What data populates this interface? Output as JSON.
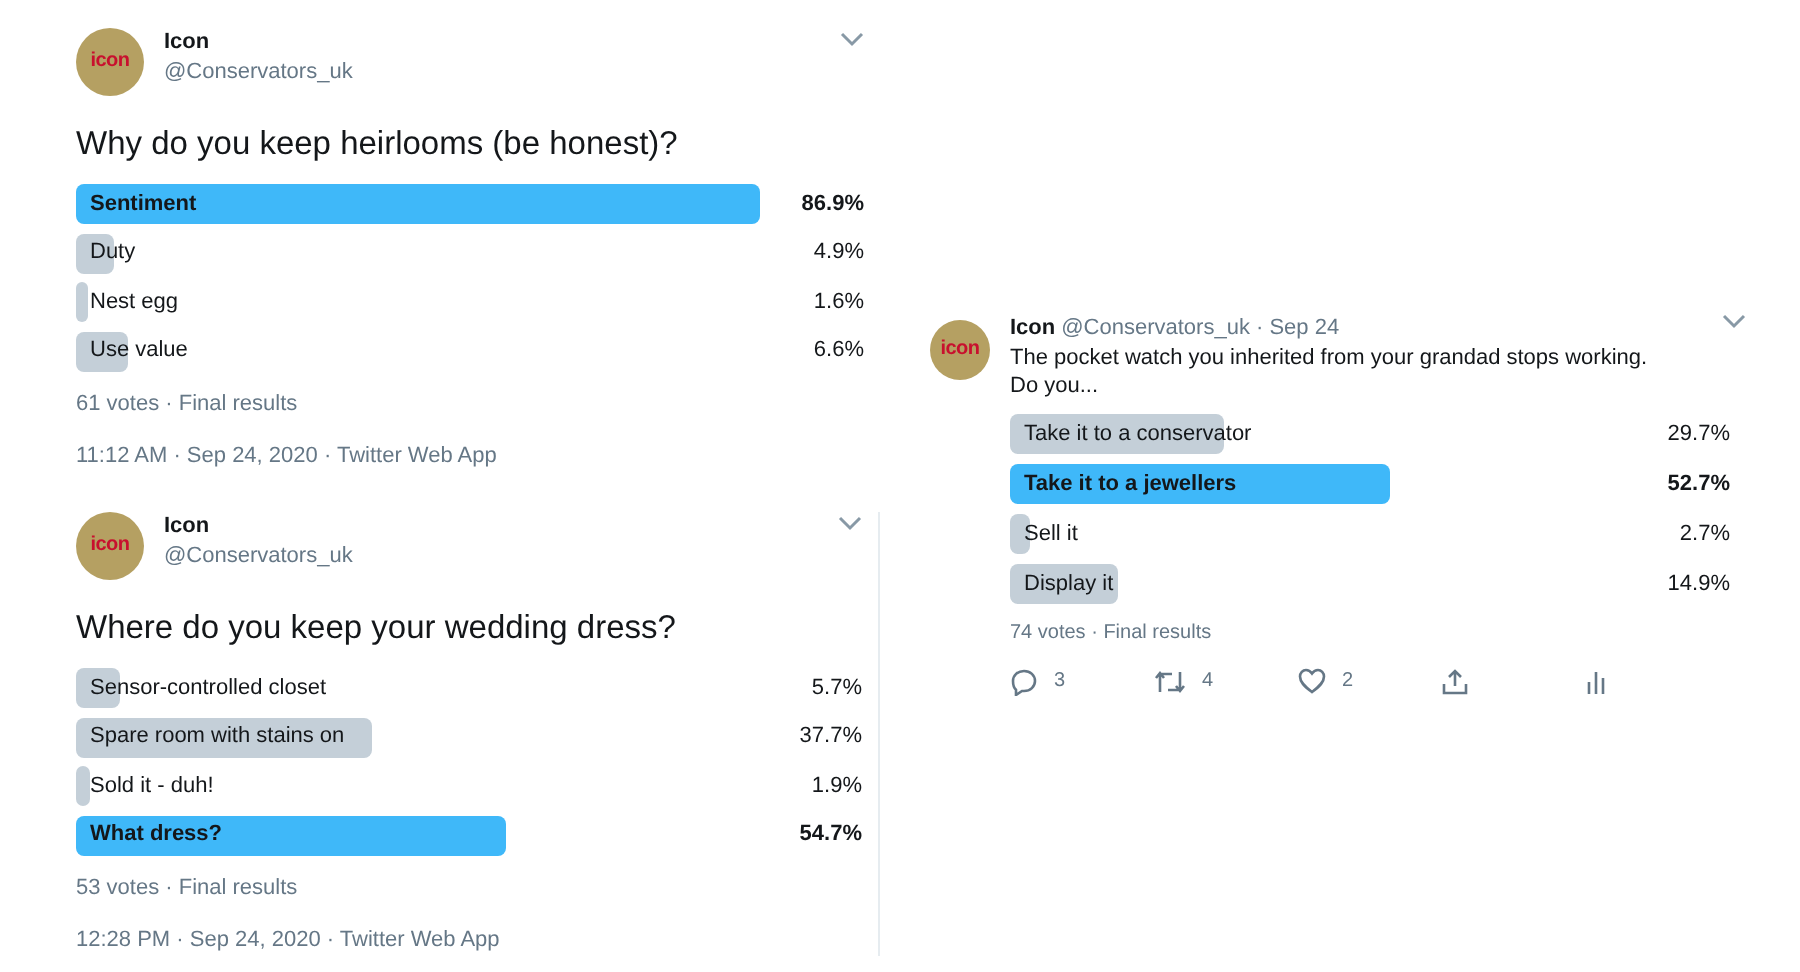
{
  "polls": [
    {
      "kind": "timeline",
      "avatar_text": "icon",
      "name": "Icon",
      "handle": "@Conservators_uk",
      "question": "Why do you keep heirlooms (be honest)?",
      "options": [
        {
          "label": "Sentiment",
          "percent": "86.9%",
          "leading": true
        },
        {
          "label": "Duty",
          "percent": "4.9%",
          "leading": false
        },
        {
          "label": "Nest egg",
          "percent": "1.6%",
          "leading": false
        },
        {
          "label": "Use value",
          "percent": "6.6%",
          "leading": false
        }
      ],
      "summary": "61 votes · Final results",
      "timestamp": "11:12 AM · Sep 24, 2020 · Twitter Web App"
    },
    {
      "kind": "timeline",
      "avatar_text": "icon",
      "name": "Icon",
      "handle": "@Conservators_uk",
      "question": "Where do you keep your wedding dress?",
      "options": [
        {
          "label": "Sensor-controlled closet",
          "percent": "5.7%",
          "leading": false
        },
        {
          "label": "Spare room with stains on",
          "percent": "37.7%",
          "leading": false
        },
        {
          "label": "Sold it - duh!",
          "percent": "1.9%",
          "leading": false
        },
        {
          "label": "What dress?",
          "percent": "54.7%",
          "leading": true
        }
      ],
      "summary": "53 votes · Final results",
      "timestamp": "12:28 PM · Sep 24, 2020 · Twitter Web App"
    },
    {
      "kind": "compact",
      "avatar_text": "icon",
      "name": "Icon",
      "handle": "@Conservators_uk · Sep 24",
      "question": "The pocket watch you inherited from your grandad stops working.\nDo you...",
      "options": [
        {
          "label": "Take it to a conservator",
          "percent": "29.7%",
          "leading": false
        },
        {
          "label": "Take it to a jewellers",
          "percent": "52.7%",
          "leading": true
        },
        {
          "label": "Sell it",
          "percent": "2.7%",
          "leading": false
        },
        {
          "label": "Display it",
          "percent": "14.9%",
          "leading": false
        }
      ],
      "summary": "74 votes · Final results",
      "actions": [
        {
          "kind": "reply",
          "count": "3"
        },
        {
          "kind": "retweet",
          "count": "4"
        },
        {
          "kind": "like",
          "count": "2"
        },
        {
          "kind": "share"
        },
        {
          "kind": "analytics"
        }
      ]
    }
  ]
}
